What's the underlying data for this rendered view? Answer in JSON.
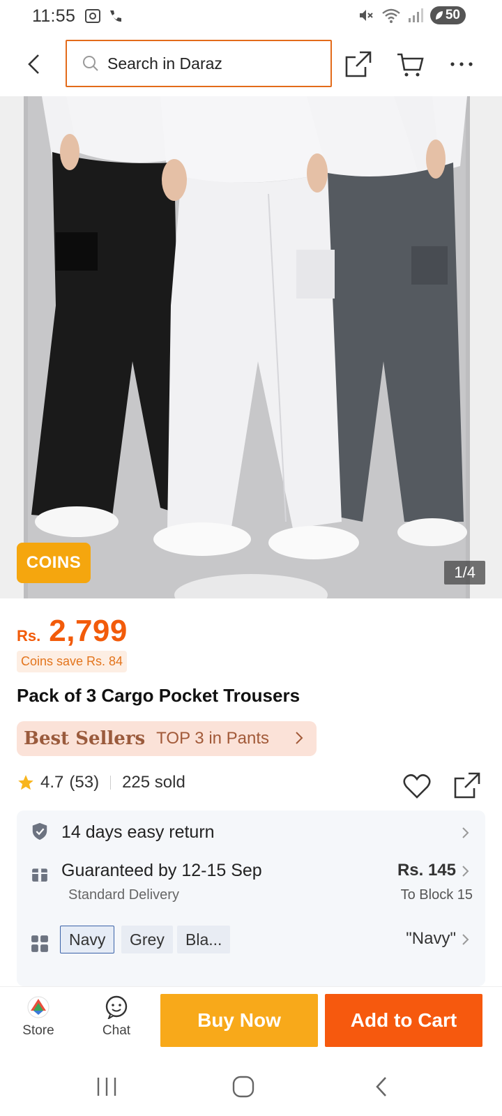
{
  "status_bar": {
    "time": "11:55",
    "battery": "50"
  },
  "search": {
    "placeholder": "Search in Daraz"
  },
  "gallery": {
    "coins_badge": "COINS",
    "counter": "1/4"
  },
  "product": {
    "currency": "Rs.",
    "price": "2,799",
    "coins_save": "Coins save Rs. 84",
    "title": "Pack of 3 Cargo Pocket Trousers",
    "best_sellers_brand": "Best Sellers",
    "best_sellers_rank": "TOP 3 in Pants",
    "rating": "4.7",
    "review_count": "(53)",
    "sold": "225 sold"
  },
  "info": {
    "return_text": "14 days easy return",
    "delivery_text": "Guaranteed by 12-15 Sep",
    "delivery_type": "Standard Delivery",
    "delivery_fee": "Rs. 145",
    "delivery_location": "To Block 15",
    "variants": [
      "Navy",
      "Grey",
      "Bla..."
    ],
    "selected_variant": "\"Navy\""
  },
  "bottom_bar": {
    "store_label": "Store",
    "chat_label": "Chat",
    "buy_now_label": "Buy Now",
    "add_to_cart_label": "Add to Cart"
  },
  "colors": {
    "accent_orange": "#f25b0a",
    "buy_now": "#f8a91a",
    "add_to_cart": "#f6590e",
    "search_border": "#e36b1a"
  }
}
